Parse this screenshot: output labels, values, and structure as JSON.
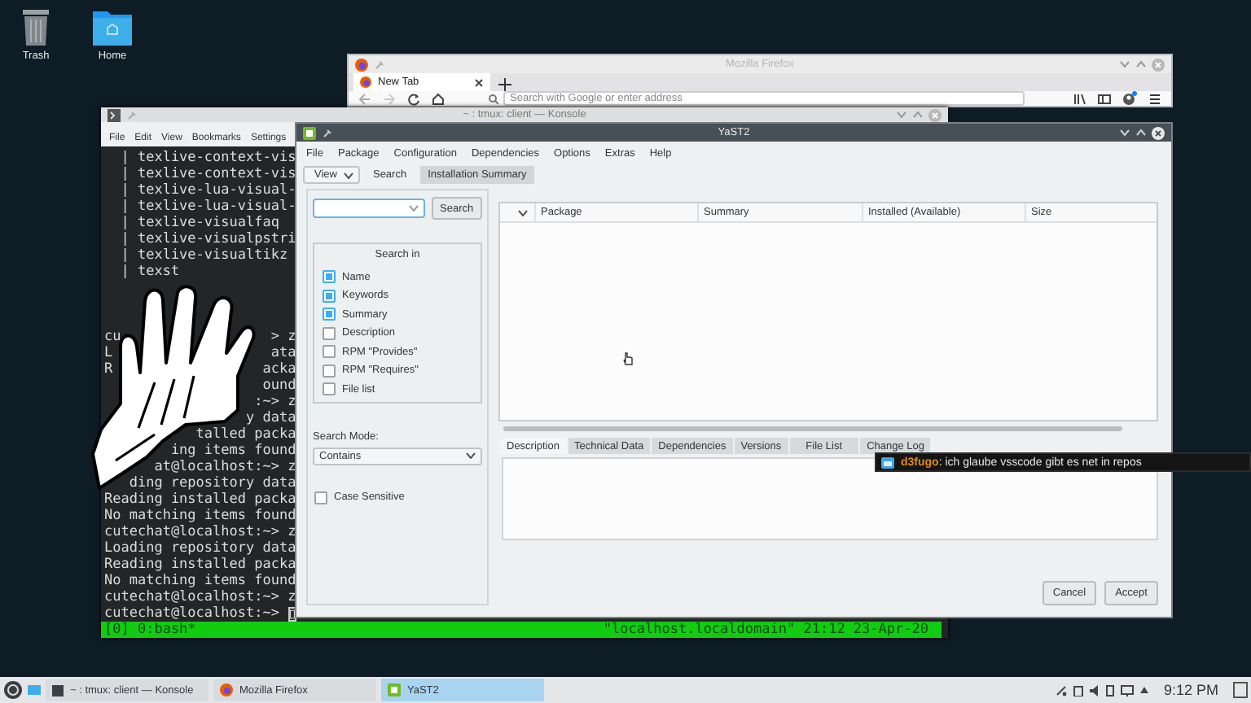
{
  "desktop_icons": [
    {
      "label": "Trash",
      "kind": "trash"
    },
    {
      "label": "Home",
      "kind": "folder"
    }
  ],
  "firefox": {
    "title": "Mozilla Firefox",
    "tabs": [
      {
        "label": "New Tab",
        "selected": true
      }
    ],
    "url_placeholder": "Search with Google or enter address"
  },
  "konsole": {
    "title": "~ : tmux: client — Konsole",
    "menu": [
      "File",
      "Edit",
      "View",
      "Bookmarks",
      "Settings"
    ],
    "output_top": [
      "  | texlive-context-vis",
      "  | texlive-context-vis",
      "  | texlive-lua-visual-",
      "  | texlive-lua-visual-",
      "  | texlive-visualfaq",
      "  | texlive-visualpstri",
      "  | texlive-visualtikz",
      "  | texst"
    ],
    "output_bottom": [
      "cu                  > z",
      "L                   ata",
      "R                  acka",
      "                   ound",
      "                  :~> z",
      "                 y data",
      "           talled packa",
      "        ing items found",
      "      at@localhost:~> z",
      "   ding repository data",
      "Reading installed packa",
      "No matching items found",
      "cutechat@localhost:~> z",
      "Loading repository data",
      "Reading installed packa",
      "No matching items found",
      "cutechat@localhost:~> z",
      "cutechat@localhost:~>"
    ],
    "status_left": "[0] 0:bash*",
    "status_right": "\"localhost.localdomain\" 21:12 23-Apr-20"
  },
  "yast": {
    "title": "YaST2",
    "menu": [
      "File",
      "Package",
      "Configuration",
      "Dependencies",
      "Options",
      "Extras",
      "Help"
    ],
    "view_button": "View",
    "tabs": [
      {
        "label": "Search",
        "selected": true
      },
      {
        "label": "Installation Summary",
        "selected": false
      }
    ],
    "search_button": "Search",
    "search_in": {
      "title": "Search in",
      "options": [
        {
          "label": "Name",
          "checked": true
        },
        {
          "label": "Keywords",
          "checked": true
        },
        {
          "label": "Summary",
          "checked": true
        },
        {
          "label": "Description",
          "checked": false
        },
        {
          "label": "RPM \"Provides\"",
          "checked": false
        },
        {
          "label": "RPM \"Requires\"",
          "checked": false
        },
        {
          "label": "File list",
          "checked": false
        }
      ]
    },
    "search_mode_label": "Search Mode:",
    "search_mode": "Contains",
    "case_sensitive": {
      "label": "Case Sensitive",
      "checked": false
    },
    "columns": [
      "Package",
      "Summary",
      "Installed (Available)",
      "Size"
    ],
    "detail_tabs": [
      {
        "label": "Description",
        "selected": true
      },
      {
        "label": "Technical Data",
        "selected": false
      },
      {
        "label": "Dependencies",
        "selected": false
      },
      {
        "label": "Versions",
        "selected": false
      },
      {
        "label": "File List",
        "selected": false
      },
      {
        "label": "Change Log",
        "selected": false
      }
    ],
    "buttons": [
      "Cancel",
      "Accept"
    ]
  },
  "chat": {
    "user": "d3fugo",
    "text": ": ich glaube vsscode gibt es net in repos"
  },
  "taskbar": {
    "tasks": [
      {
        "label": "~ : tmux: client — Konsole",
        "kind": "terminal",
        "selected": false
      },
      {
        "label": "Mozilla Firefox",
        "kind": "browser",
        "selected": false
      },
      {
        "label": "YaST2",
        "kind": "yast",
        "selected": true
      }
    ],
    "clock": "9:12 PM"
  }
}
